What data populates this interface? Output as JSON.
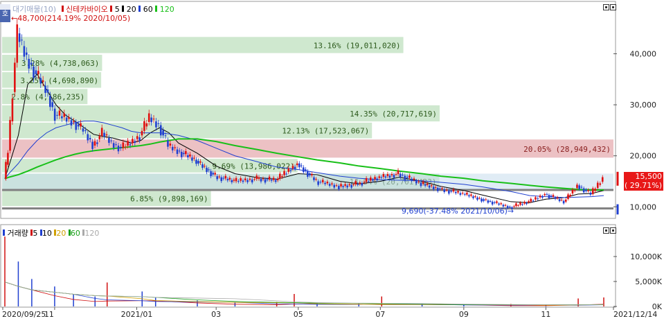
{
  "tab_label": "호",
  "price_panel": {
    "header_items": [
      {
        "text": "대기매물(10)",
        "color": "#9aa7c7"
      },
      {
        "text": "신테카바이오",
        "color": "#d01010"
      },
      {
        "text": "5",
        "color": "#d01010"
      },
      {
        "text": "20",
        "color": "#000000"
      },
      {
        "text": "60",
        "color": "#1f3fd0"
      },
      {
        "text": "120",
        "color": "#18c018"
      }
    ],
    "high_label": "48,700(214.19% 2020/10/05)",
    "low_label": "9,690(-37.48% 2021/10/06)",
    "last_price": "15,500",
    "last_change": "( 29.71%)",
    "y_ticks": [
      "40,000",
      "30,000",
      "20,000",
      "10,000"
    ]
  },
  "volume_panel": {
    "header_items": [
      {
        "text": "거래량",
        "color": "#000000"
      },
      {
        "text": "5",
        "color": "#d01010"
      },
      {
        "text": "10",
        "color": "#1f3fd0"
      },
      {
        "text": "20",
        "color": "#d0a000"
      },
      {
        "text": "60",
        "color": "#18a018"
      },
      {
        "text": "120",
        "color": "#aaaaaa"
      }
    ],
    "y_ticks": [
      "10,000K",
      "5,000K",
      "0K"
    ]
  },
  "x_ticks": [
    "2020/09/25",
    "11",
    "2021/01",
    "03",
    "05",
    "07",
    "09",
    "11",
    "2021/12/14"
  ],
  "chart_data": {
    "type": "candlestick",
    "price_ylim": [
      8000,
      50000
    ],
    "volume_ylim": [
      0,
      15000
    ],
    "x_range": [
      "2020/09/25",
      "2021/12/14"
    ],
    "supply_bands": [
      {
        "label": "13.16% (19,011,020)",
        "low": 40000,
        "high": 43300,
        "highlight": false
      },
      {
        "label": "3.28% (4,738,063)",
        "low": 36500,
        "high": 39800,
        "highlight": false
      },
      {
        "label": "3.25% (4,698,890)",
        "low": 33200,
        "high": 36400,
        "highlight": false
      },
      {
        "label": "2.8% (4,186,235)",
        "low": 30000,
        "high": 33100,
        "highlight": false
      },
      {
        "label": "14.35% (20,717,619)",
        "low": 26600,
        "high": 29900,
        "highlight": false
      },
      {
        "label": "12.13% (17,523,067)",
        "low": 23300,
        "high": 26500,
        "highlight": false
      },
      {
        "label": "20.05% (28,949,432)",
        "low": 19500,
        "high": 23200,
        "highlight": true
      },
      {
        "label": "9.69% (13,986,022)",
        "low": 16600,
        "high": 19400,
        "highlight": false
      },
      {
        "label": "14.34% (20,701,423)",
        "low": 13300,
        "high": 16500,
        "highlight": false
      },
      {
        "label": "6.85% (9,898,169)",
        "low": 10000,
        "high": 13200,
        "highlight": false
      }
    ],
    "horizontal_lines": [
      13300,
      9690
    ],
    "close_series": [
      {
        "date": "2020/09/25",
        "close": 15500
      },
      {
        "date": "2020/09/28",
        "close": 21000
      },
      {
        "date": "2020/10/05",
        "close": 44000
      },
      {
        "date": "2020/10/12",
        "close": 39000
      },
      {
        "date": "2020/10/19",
        "close": 36000
      },
      {
        "date": "2020/10/26",
        "close": 33000
      },
      {
        "date": "2020/11/02",
        "close": 28000
      },
      {
        "date": "2020/11/09",
        "close": 27500
      },
      {
        "date": "2020/11/16",
        "close": 26500
      },
      {
        "date": "2020/11/23",
        "close": 25000
      },
      {
        "date": "2020/11/30",
        "close": 22000
      },
      {
        "date": "2020/12/07",
        "close": 24500
      },
      {
        "date": "2020/12/14",
        "close": 22500
      },
      {
        "date": "2020/12/21",
        "close": 21500
      },
      {
        "date": "2020/12/28",
        "close": 22500
      },
      {
        "date": "2021/01/04",
        "close": 24000
      },
      {
        "date": "2021/01/11",
        "close": 27500
      },
      {
        "date": "2021/01/18",
        "close": 26000
      },
      {
        "date": "2021/01/25",
        "close": 22000
      },
      {
        "date": "2021/02/01",
        "close": 21000
      },
      {
        "date": "2021/02/15",
        "close": 19000
      },
      {
        "date": "2021/03/01",
        "close": 16000
      },
      {
        "date": "2021/03/15",
        "close": 15000
      },
      {
        "date": "2021/04/01",
        "close": 15500
      },
      {
        "date": "2021/04/15",
        "close": 15200
      },
      {
        "date": "2021/05/01",
        "close": 18500
      },
      {
        "date": "2021/05/15",
        "close": 15000
      },
      {
        "date": "2021/06/01",
        "close": 14000
      },
      {
        "date": "2021/06/15",
        "close": 14500
      },
      {
        "date": "2021/07/01",
        "close": 15800
      },
      {
        "date": "2021/07/15",
        "close": 16500
      },
      {
        "date": "2021/08/01",
        "close": 14500
      },
      {
        "date": "2021/08/15",
        "close": 13500
      },
      {
        "date": "2021/09/01",
        "close": 12500
      },
      {
        "date": "2021/09/15",
        "close": 11500
      },
      {
        "date": "2021/10/06",
        "close": 9900
      },
      {
        "date": "2021/10/20",
        "close": 11000
      },
      {
        "date": "2021/11/01",
        "close": 12500
      },
      {
        "date": "2021/11/15",
        "close": 11000
      },
      {
        "date": "2021/11/25",
        "close": 14200
      },
      {
        "date": "2021/12/05",
        "close": 12500
      },
      {
        "date": "2021/12/14",
        "close": 15500
      }
    ],
    "moving_averages": [
      {
        "name": "20",
        "color": "#000000",
        "values": [
          15500,
          18000,
          24000,
          34000,
          36000,
          33000,
          30000,
          28000,
          26800,
          25500,
          24200,
          23800,
          23500,
          23000,
          22500,
          23000,
          24500,
          25500,
          24500,
          22500,
          20500,
          18000,
          16500,
          15700,
          15400,
          16500,
          16300,
          15000,
          14500,
          15000,
          15800,
          15000,
          14000,
          13200,
          12300,
          11000,
          10800,
          11500,
          11800,
          12500,
          12600,
          13200
        ]
      },
      {
        "name": "60",
        "color": "#1f3fd0",
        "values": [
          15500,
          16500,
          18500,
          21000,
          23000,
          24500,
          25500,
          26000,
          26500,
          26800,
          26800,
          26500,
          26000,
          25500,
          24800,
          24500,
          24500,
          24500,
          24300,
          24000,
          23000,
          21500,
          20000,
          18800,
          17800,
          17300,
          16700,
          16000,
          15600,
          15300,
          15200,
          15100,
          14800,
          14400,
          13900,
          13000,
          12200,
          12000,
          11800,
          11900,
          12000,
          12200
        ]
      },
      {
        "name": "120",
        "color": "#18c018",
        "values": [
          15500,
          15800,
          16300,
          17000,
          17800,
          18500,
          19200,
          19800,
          20300,
          20700,
          21000,
          21200,
          21400,
          21600,
          21800,
          22000,
          22300,
          22700,
          23000,
          23300,
          23300,
          22800,
          22000,
          21200,
          20500,
          19800,
          19200,
          18600,
          18000,
          17500,
          17000,
          16500,
          16000,
          15600,
          15100,
          14600,
          14200,
          13900,
          13600,
          13400,
          13300,
          13300
        ]
      }
    ],
    "volume_bars": [
      {
        "date": "2020/09/25",
        "volume": 14000
      },
      {
        "date": "2020/10/05",
        "volume": 9000
      },
      {
        "date": "2020/10/15",
        "volume": 5500
      },
      {
        "date": "2020/11/01",
        "volume": 4000
      },
      {
        "date": "2020/11/15",
        "volume": 2500
      },
      {
        "date": "2020/12/01",
        "volume": 2000
      },
      {
        "date": "2020/12/10",
        "volume": 4800
      },
      {
        "date": "2021/01/05",
        "volume": 3000
      },
      {
        "date": "2021/01/15",
        "volume": 1800
      },
      {
        "date": "2021/02/15",
        "volume": 1200
      },
      {
        "date": "2021/03/15",
        "volume": 800
      },
      {
        "date": "2021/04/15",
        "volume": 900
      },
      {
        "date": "2021/04/28",
        "volume": 2500
      },
      {
        "date": "2021/05/15",
        "volume": 700
      },
      {
        "date": "2021/06/15",
        "volume": 600
      },
      {
        "date": "2021/07/02",
        "volume": 2000
      },
      {
        "date": "2021/08/01",
        "volume": 500
      },
      {
        "date": "2021/09/01",
        "volume": 400
      },
      {
        "date": "2021/10/06",
        "volume": 500
      },
      {
        "date": "2021/11/01",
        "volume": 400
      },
      {
        "date": "2021/11/25",
        "volume": 1600
      },
      {
        "date": "2021/12/14",
        "volume": 1800
      }
    ]
  }
}
